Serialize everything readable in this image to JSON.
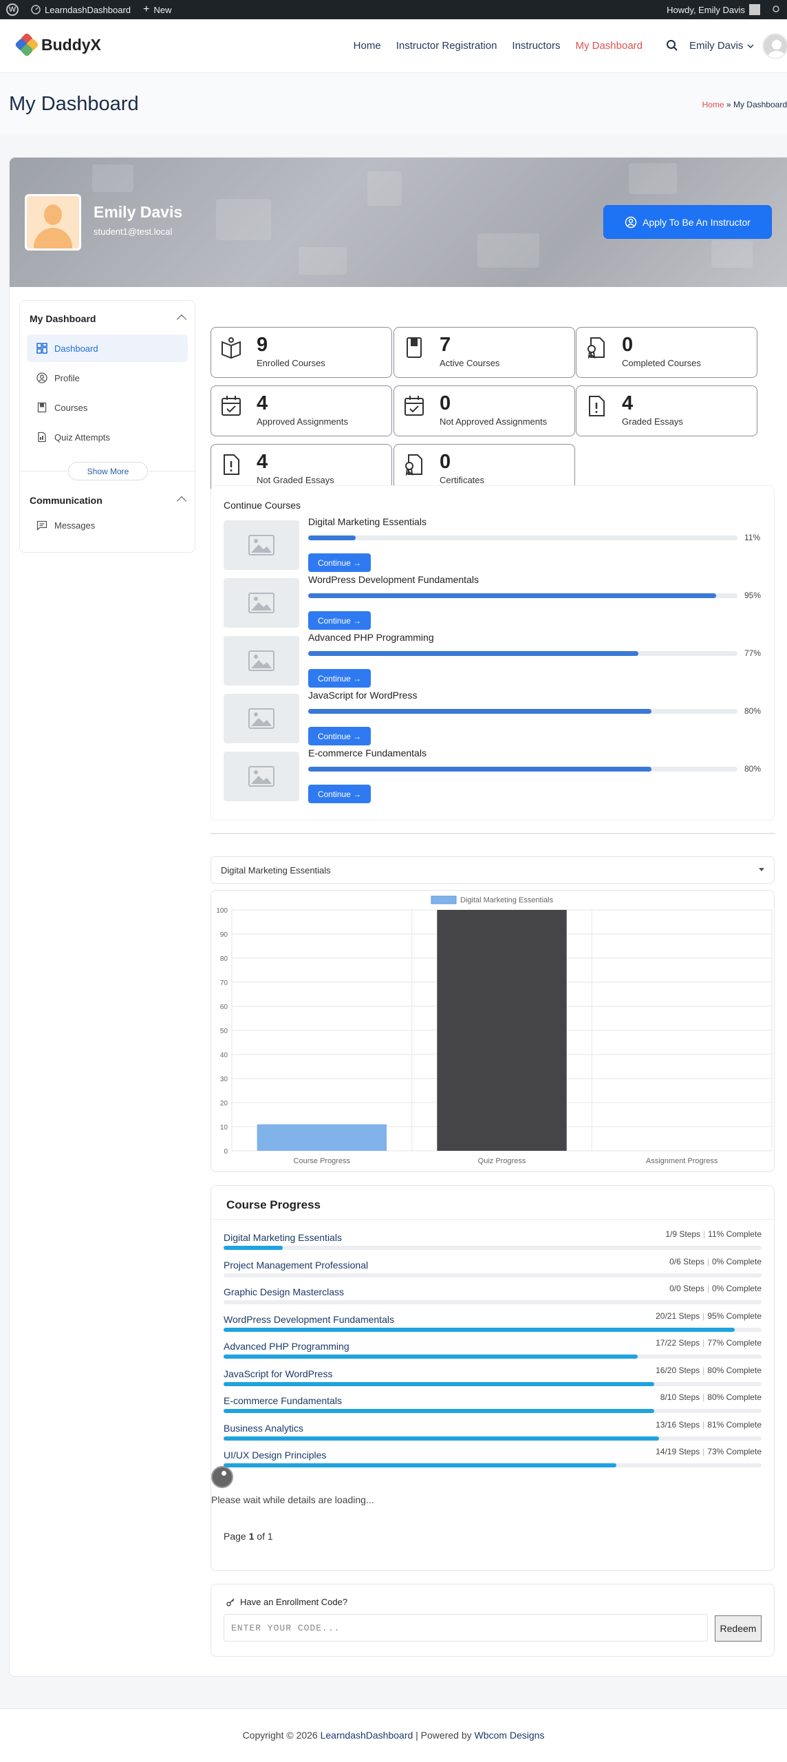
{
  "admin_bar": {
    "site": "LearndashDashboard",
    "new": "New",
    "howdy": "Howdy, Emily Davis"
  },
  "header": {
    "logo": "BuddyX",
    "nav": [
      "Home",
      "Instructor Registration",
      "Instructors",
      "My Dashboard"
    ],
    "active_nav": "My Dashboard",
    "user": "Emily Davis",
    "accent": "#e0514f"
  },
  "page": {
    "title": "My Dashboard",
    "breadcrumb_home": "Home",
    "breadcrumb_sep": "»",
    "breadcrumb_current": "My Dashboard"
  },
  "profile": {
    "name": "Emily Davis",
    "email": "student1@test.local",
    "apply_label": "Apply To Be An Instructor"
  },
  "sidebar": {
    "section1": "My Dashboard",
    "items": [
      {
        "label": "Dashboard",
        "icon": "dashboard-icon",
        "active": true
      },
      {
        "label": "Profile",
        "icon": "profile-icon"
      },
      {
        "label": "Courses",
        "icon": "book-icon"
      },
      {
        "label": "Quiz Attempts",
        "icon": "quiz-icon"
      }
    ],
    "show_more": "Show More",
    "section2": "Communication",
    "messages": "Messages"
  },
  "stats": [
    {
      "value": "9",
      "label": "Enrolled Courses",
      "icon": "open-book-icon"
    },
    {
      "value": "7",
      "label": "Active Courses",
      "icon": "book-icon"
    },
    {
      "value": "0",
      "label": "Completed Courses",
      "icon": "certificate-icon"
    },
    {
      "value": "4",
      "label": "Approved Assignments",
      "icon": "calendar-check-icon"
    },
    {
      "value": "0",
      "label": "Not Approved Assignments",
      "icon": "calendar-check-icon"
    },
    {
      "value": "4",
      "label": "Graded Essays",
      "icon": "essay-alert-icon"
    },
    {
      "value": "4",
      "label": "Not Graded Essays",
      "icon": "essay-alert-icon"
    },
    {
      "value": "0",
      "label": "Certificates",
      "icon": "certificate-icon"
    }
  ],
  "continue_courses": {
    "title": "Continue Courses",
    "button": "Continue →",
    "items": [
      {
        "name": "Digital Marketing Essentials",
        "progress": 11,
        "pct": "11%"
      },
      {
        "name": "WordPress Development Fundamentals",
        "progress": 95,
        "pct": "95%"
      },
      {
        "name": "Advanced PHP Programming",
        "progress": 77,
        "pct": "77%"
      },
      {
        "name": "JavaScript for WordPress",
        "progress": 80,
        "pct": "80%"
      },
      {
        "name": "E-commerce Fundamentals",
        "progress": 80,
        "pct": "80%"
      }
    ]
  },
  "course_select": {
    "value": "Digital Marketing Essentials"
  },
  "chart_data": {
    "type": "bar",
    "categories": [
      "Course Progress",
      "Quiz Progress",
      "Assignment Progress"
    ],
    "series": [
      {
        "name": "Digital Marketing Essentials",
        "values": [
          11,
          100,
          0
        ]
      }
    ],
    "bar_colors": [
      "#7fb3ea",
      "#454548",
      "#7fb3ea"
    ],
    "ylim": [
      0,
      100
    ],
    "yticks": [
      0,
      10,
      20,
      30,
      40,
      50,
      60,
      70,
      80,
      90,
      100
    ],
    "grid": true,
    "legend": "top"
  },
  "course_progress": {
    "title": "Course Progress",
    "items": [
      {
        "name": "Digital Marketing Essentials",
        "steps": "1/9 Steps",
        "complete": "11% Complete",
        "progress": 11
      },
      {
        "name": "Project Management Professional",
        "steps": "0/6 Steps",
        "complete": "0% Complete",
        "progress": 0
      },
      {
        "name": "Graphic Design Masterclass",
        "steps": "0/0 Steps",
        "complete": "0% Complete",
        "progress": 0
      },
      {
        "name": "WordPress Development Fundamentals",
        "steps": "20/21 Steps",
        "complete": "95% Complete",
        "progress": 95
      },
      {
        "name": "Advanced PHP Programming",
        "steps": "17/22 Steps",
        "complete": "77% Complete",
        "progress": 77
      },
      {
        "name": "JavaScript for WordPress",
        "steps": "16/20 Steps",
        "complete": "80% Complete",
        "progress": 80
      },
      {
        "name": "E-commerce Fundamentals",
        "steps": "8/10 Steps",
        "complete": "80% Complete",
        "progress": 80
      },
      {
        "name": "Business Analytics",
        "steps": "13/16 Steps",
        "complete": "81% Complete",
        "progress": 81
      },
      {
        "name": "UI/UX Design Principles",
        "steps": "14/19 Steps",
        "complete": "73% Complete",
        "progress": 73
      }
    ],
    "loading": "Please wait while details are loading...",
    "page_label": "Page",
    "page_current": "1",
    "page_of": "of 1"
  },
  "enrollment": {
    "title": "Have an Enrollment Code?",
    "placeholder": "ENTER YOUR CODE...",
    "button": "Redeem"
  },
  "footer": {
    "copyright": "Copyright © 2026",
    "site": "LearndashDashboard",
    "powered": "| Powered by",
    "company": "Wbcom Designs"
  }
}
